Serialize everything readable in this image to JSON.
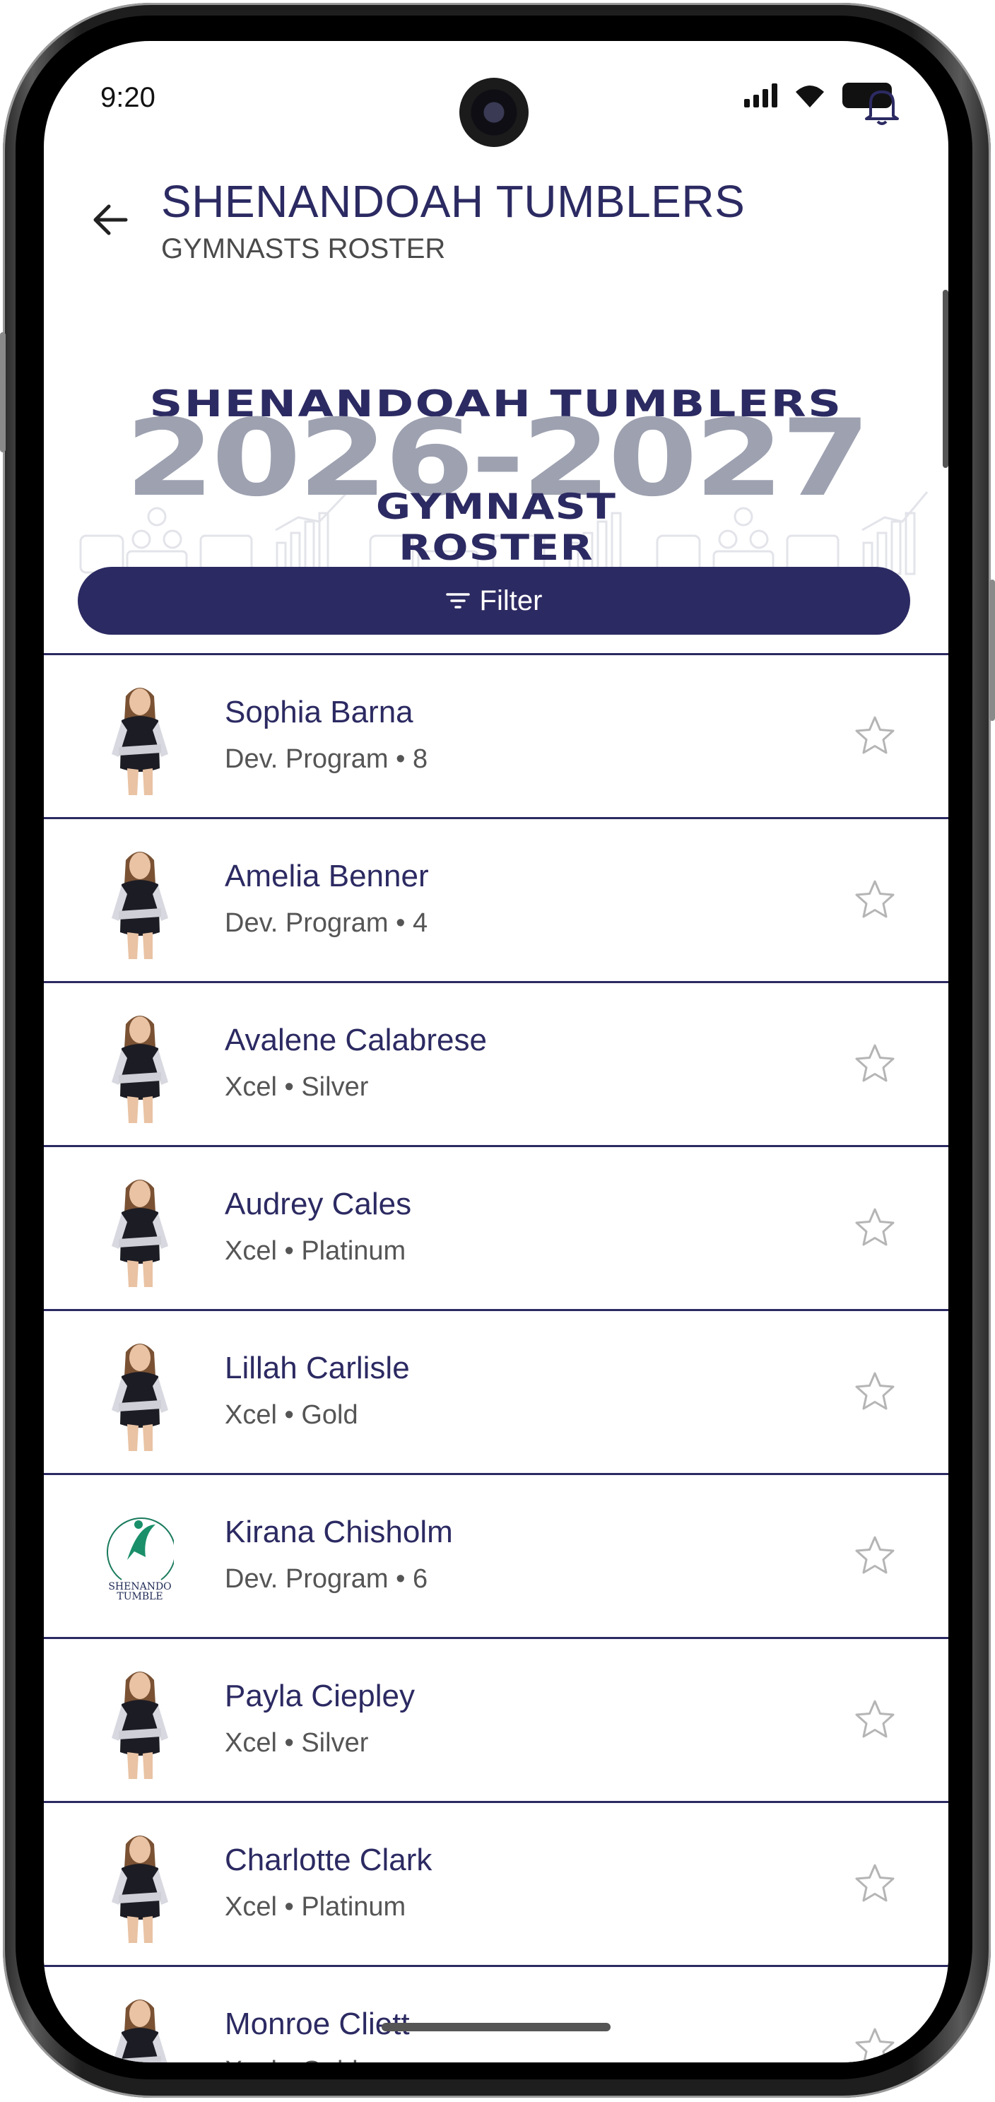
{
  "status_bar": {
    "time": "9:20"
  },
  "header": {
    "title": "SHENANDOAH TUMBLERS",
    "subtitle": "GYMNASTS ROSTER"
  },
  "banner": {
    "team": "SHENANDOAH TUMBLERS",
    "year": "2026-2027",
    "line1": "GYMNAST",
    "line2": "ROSTER"
  },
  "filter": {
    "label": "Filter"
  },
  "colors": {
    "brand": "#2c2a62",
    "banner_year": "#9da1b0",
    "star": "#b5b5b5"
  },
  "gymnasts": [
    {
      "name": "Sophia Barna",
      "detail": "Dev. Program • 8",
      "photo": "gymnast-photo"
    },
    {
      "name": "Amelia Benner",
      "detail": "Dev. Program • 4",
      "photo": "gymnast-photo"
    },
    {
      "name": "Avalene Calabrese",
      "detail": "Xcel • Silver",
      "photo": "gymnast-photo"
    },
    {
      "name": "Audrey Cales",
      "detail": "Xcel • Platinum",
      "photo": "gymnast-photo"
    },
    {
      "name": "Lillah Carlisle",
      "detail": "Xcel • Gold",
      "photo": "gymnast-photo"
    },
    {
      "name": "Kirana Chisholm",
      "detail": "Dev. Program • 6",
      "photo": "team-logo"
    },
    {
      "name": "Payla Ciepley",
      "detail": "Xcel • Silver",
      "photo": "gymnast-photo"
    },
    {
      "name": "Charlotte Clark",
      "detail": "Xcel • Platinum",
      "photo": "gymnast-photo"
    },
    {
      "name": "Monroe Cliett",
      "detail": "Xcel • Gold",
      "photo": "gymnast-photo"
    }
  ]
}
